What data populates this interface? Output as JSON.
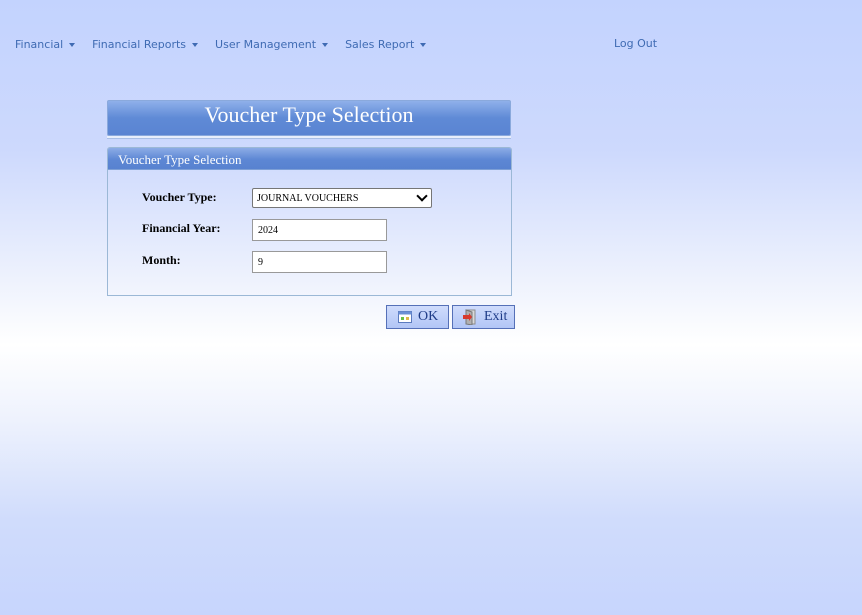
{
  "nav": {
    "items": [
      {
        "label": "Financial"
      },
      {
        "label": "Financial Reports"
      },
      {
        "label": "User Management"
      },
      {
        "label": "Sales Report"
      }
    ],
    "logout_label": "Log Out"
  },
  "page": {
    "title": "Voucher Type Selection"
  },
  "panel": {
    "header": "Voucher Type Selection",
    "voucher_type_label": "Voucher Type:",
    "voucher_type_value": "JOURNAL VOUCHERS",
    "financial_year_label": "Financial Year:",
    "financial_year_value": "2024",
    "month_label": "Month:",
    "month_value": "9"
  },
  "actions": {
    "ok_label": "OK",
    "exit_label": "Exit"
  },
  "icons": {
    "dropdown": "caret-down-icon",
    "ok": "calendar-check-icon",
    "exit": "exit-door-icon"
  },
  "colors": {
    "nav_text": "#3f6bb3",
    "header_blue": "#5d87d4",
    "button_text": "#1f3c88"
  }
}
